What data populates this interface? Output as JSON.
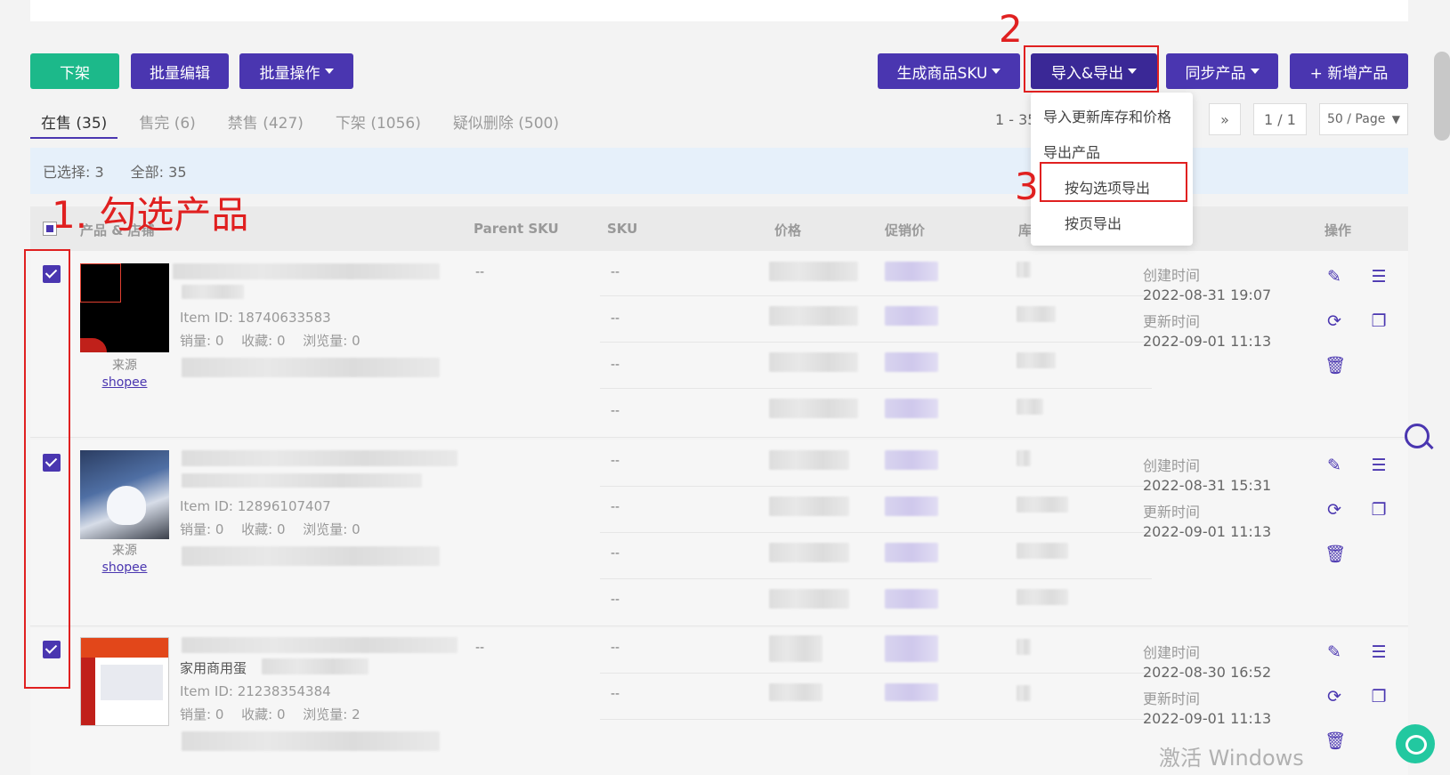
{
  "toolbar": {
    "unlist": "下架",
    "bulk_edit": "批量编辑",
    "bulk_ops": "批量操作",
    "gen_sku": "生成商品SKU",
    "import_export": "导入&导出",
    "sync": "同步产品",
    "add_product": "+ 新增产品"
  },
  "tabs": [
    {
      "label": "在售 (35)"
    },
    {
      "label": "售完 (6)"
    },
    {
      "label": "禁售 (427)"
    },
    {
      "label": "下架 (1056)"
    },
    {
      "label": "疑似删除 (500)"
    }
  ],
  "pager": {
    "range": "1 - 35",
    "next_icon": "»",
    "page": "1 / 1",
    "per_page": "50 / Page"
  },
  "selection": {
    "selected": "已选择: 3",
    "total": "全部: 35"
  },
  "columns": {
    "product": "产品 & 店铺",
    "parent_sku": "Parent SKU",
    "sku": "SKU",
    "price": "价格",
    "promo": "促销价",
    "stock": "库",
    "ops": "操作"
  },
  "dropdown": {
    "import_update": "导入更新库存和价格",
    "export_products": "导出产品",
    "export_checked": "按勾选项导出",
    "export_page": "按页导出"
  },
  "annotations": {
    "step1": "1. 勾选产品",
    "step2": "2",
    "step3": "3"
  },
  "rows": [
    {
      "item_id": "Item ID: 18740633583",
      "stats": "销量: 0　 收藏: 0　 浏览量: 0",
      "source_label": "来源",
      "source_link": "shopee",
      "parent_sku": "--",
      "created_label": "创建时间",
      "created": "2022-08-31 19:07",
      "updated_label": "更新时间",
      "updated": "2022-09-01 11:13"
    },
    {
      "item_id": "Item ID: 12896107407",
      "stats": "销量: 0　 收藏: 0　 浏览量: 0",
      "source_label": "来源",
      "source_link": "shopee",
      "parent_sku": "--",
      "created_label": "创建时间",
      "created": "2022-08-31 15:31",
      "updated_label": "更新时间",
      "updated": "2022-09-01 11:13"
    },
    {
      "item_id": "Item ID: 21238354384",
      "title_fragment": "家用商用蛋",
      "stats": "销量: 0　 收藏: 0　 浏览量: 2",
      "parent_sku": "--",
      "created_label": "创建时间",
      "created": "2022-08-30 16:52",
      "updated_label": "更新时间",
      "updated": "2022-09-01 11:13"
    }
  ],
  "sku_dash": "--",
  "watermark": "激活 Windows",
  "colors": {
    "accent": "#4a36b0",
    "green": "#1cb98a",
    "annotation": "#e02020",
    "selection_bar": "#e6f0fa"
  }
}
